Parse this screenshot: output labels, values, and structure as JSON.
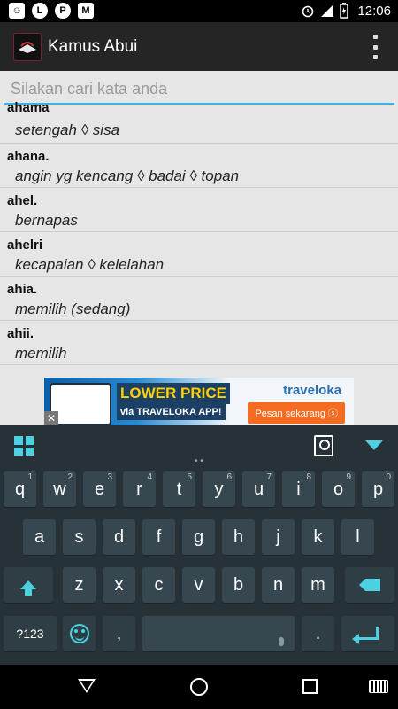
{
  "status_bar": {
    "icons": [
      "hangouts-icon",
      "line-icon",
      "pinterest-icon",
      "gmail-icon"
    ],
    "icon_glyphs": [
      "☺",
      "L",
      "P",
      "M"
    ],
    "time": "12:06"
  },
  "app_bar": {
    "title": "Kamus Abui"
  },
  "search": {
    "placeholder": "Silakan cari kata anda",
    "value": ""
  },
  "entries": [
    {
      "word": "ahama",
      "meaning": "setengah ◊ sisa"
    },
    {
      "word": "ahana.",
      "meaning": "angin yg kencang ◊ badai ◊ topan"
    },
    {
      "word": "ahel.",
      "meaning": "bernapas"
    },
    {
      "word": "ahelri",
      "meaning": "kecapaian ◊ kelelahan"
    },
    {
      "word": "ahia.",
      "meaning": "memilih (sedang)"
    },
    {
      "word": "ahii.",
      "meaning": "memilih"
    }
  ],
  "ad": {
    "headline": "LOWER PRICE",
    "sub": "via TRAVELOKA APP!",
    "brand": "traveloka",
    "cta": "Pesan sekarang ⓢ",
    "close": "✕"
  },
  "keyboard": {
    "row1": [
      {
        "key": "q",
        "hint": "1"
      },
      {
        "key": "w",
        "hint": "2"
      },
      {
        "key": "e",
        "hint": "3"
      },
      {
        "key": "r",
        "hint": "4"
      },
      {
        "key": "t",
        "hint": "5"
      },
      {
        "key": "y",
        "hint": "6"
      },
      {
        "key": "u",
        "hint": "7"
      },
      {
        "key": "i",
        "hint": "8"
      },
      {
        "key": "o",
        "hint": "9"
      },
      {
        "key": "p",
        "hint": "0"
      }
    ],
    "row2": [
      "a",
      "s",
      "d",
      "f",
      "g",
      "h",
      "j",
      "k",
      "l"
    ],
    "row3": [
      "z",
      "x",
      "c",
      "v",
      "b",
      "n",
      "m"
    ],
    "symbols_label": "?123",
    "comma": ",",
    "period": ".",
    "suggestion_dots": "• •"
  },
  "colors": {
    "accent": "#4dd0e1",
    "keyboard_bg": "#263238",
    "key_bg": "#37474f",
    "content_bg": "#e6e6e6",
    "search_underline": "#33b5e5"
  }
}
